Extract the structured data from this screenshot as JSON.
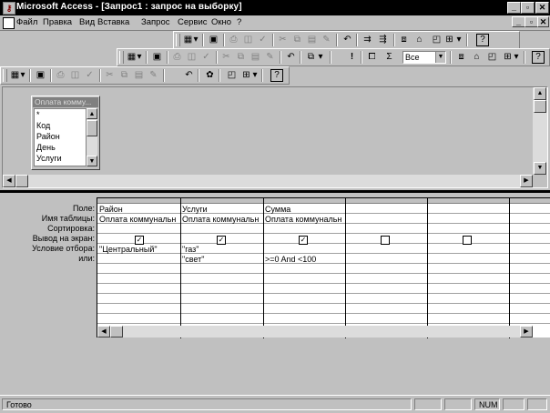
{
  "window": {
    "title": "Microsoft Access - [Запрос1 : запрос на выборку]",
    "controls": [
      "_",
      "▫",
      "✕"
    ]
  },
  "menu": [
    "Файл",
    "Правка",
    "Вид",
    "Вставка",
    "Запрос",
    "Сервис",
    "Окно",
    "?"
  ],
  "toolbar": {
    "top_values": "Все"
  },
  "field_list": {
    "title": "Оплата комму...",
    "items": [
      "*",
      "Код",
      "Район",
      "День",
      "Услуги"
    ]
  },
  "grid": {
    "row_labels": [
      "Поле:",
      "Имя таблицы:",
      "Сортировка:",
      "Вывод на экран:",
      "Условие отбора:",
      "или:"
    ],
    "columns": [
      {
        "field": "Район",
        "table": "Оплата коммунальн",
        "sort": "",
        "show": true,
        "criteria": "\"Центральный\"",
        "or": ""
      },
      {
        "field": "Услуги",
        "table": "Оплата коммунальн",
        "sort": "",
        "show": true,
        "criteria": "\"газ\"",
        "or": "\"свет\""
      },
      {
        "field": "Сумма",
        "table": "Оплата коммунальн",
        "sort": "",
        "show": true,
        "criteria": "",
        "or": ">=0 And <100"
      },
      {
        "field": "",
        "table": "",
        "sort": "",
        "show": false,
        "criteria": "",
        "or": ""
      },
      {
        "field": "",
        "table": "",
        "sort": "",
        "show": false,
        "criteria": "",
        "or": ""
      }
    ]
  },
  "status": {
    "text": "Готово",
    "num": "NUM"
  }
}
